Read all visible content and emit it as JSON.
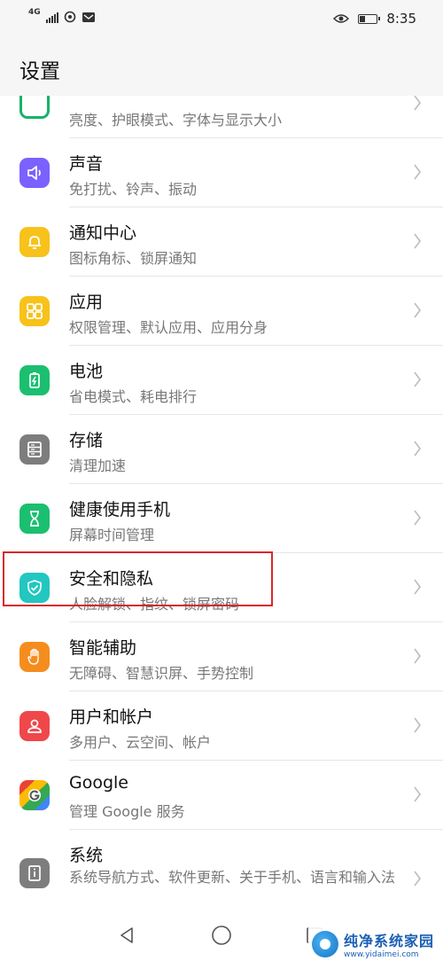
{
  "statusbar": {
    "network": "4G",
    "time": "8:35"
  },
  "header": {
    "title": "设置"
  },
  "items": [
    {
      "title": "",
      "subtitle": "亮度、护眼模式、字体与显示大小",
      "icon": "display-icon",
      "color": "#17b26a"
    },
    {
      "title": "声音",
      "subtitle": "免打扰、铃声、振动",
      "icon": "speaker-icon",
      "color": "#7b61ff"
    },
    {
      "title": "通知中心",
      "subtitle": "图标角标、锁屏通知",
      "icon": "bell-icon",
      "color": "#f7c21a"
    },
    {
      "title": "应用",
      "subtitle": "权限管理、默认应用、应用分身",
      "icon": "apps-icon",
      "color": "#f7c21a"
    },
    {
      "title": "电池",
      "subtitle": "省电模式、耗电排行",
      "icon": "battery-icon",
      "color": "#1bbf70"
    },
    {
      "title": "存储",
      "subtitle": "清理加速",
      "icon": "storage-icon",
      "color": "#7d7d7d"
    },
    {
      "title": "健康使用手机",
      "subtitle": "屏幕时间管理",
      "icon": "hourglass-icon",
      "color": "#1bbf70"
    },
    {
      "title": "安全和隐私",
      "subtitle": "人脸解锁、指纹、锁屏密码",
      "icon": "shield-icon",
      "color": "#21c7c0"
    },
    {
      "title": "智能辅助",
      "subtitle": "无障碍、智慧识屏、手势控制",
      "icon": "hand-icon",
      "color": "#f58d1e"
    },
    {
      "title": "用户和帐户",
      "subtitle": "多用户、云空间、帐户",
      "icon": "user-icon",
      "color": "#f0474b"
    },
    {
      "title": "Google",
      "subtitle": "管理 Google 服务",
      "icon": "google-icon",
      "color": "#ffffff"
    },
    {
      "title": "系统",
      "subtitle": "系统导航方式、软件更新、关于手机、语言和输入法",
      "icon": "info-icon",
      "color": "#7d7d7d"
    }
  ],
  "watermark": {
    "name": "纯净系统家园",
    "url": "www.yidaimei.com"
  }
}
